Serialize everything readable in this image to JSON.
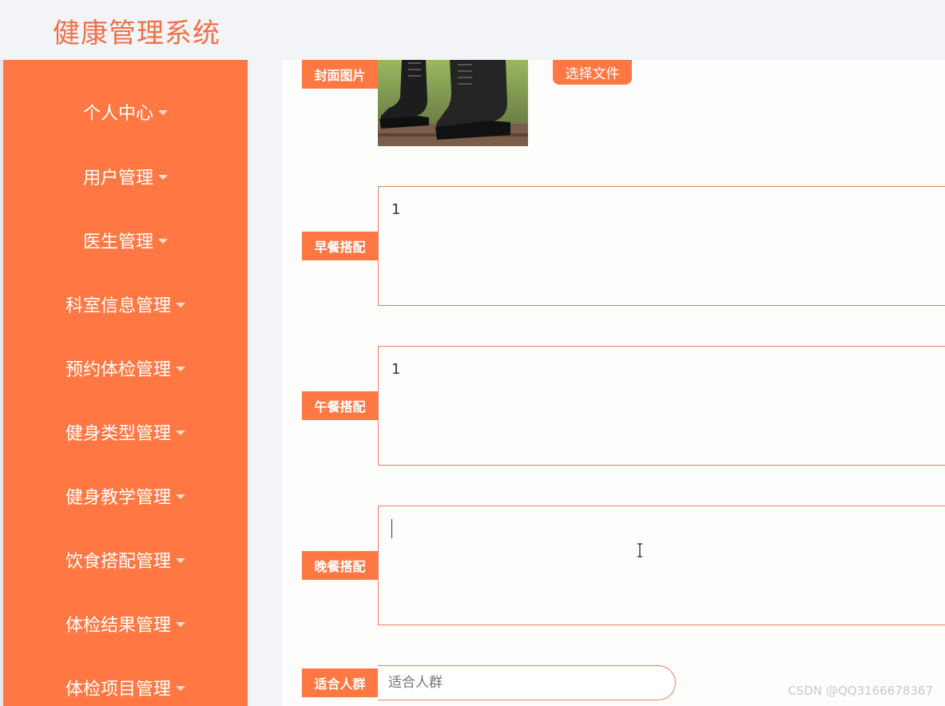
{
  "header": {
    "title": "健康管理系统"
  },
  "sidebar": {
    "items": [
      {
        "label": "个人中心"
      },
      {
        "label": "用户管理"
      },
      {
        "label": "医生管理"
      },
      {
        "label": "科室信息管理"
      },
      {
        "label": "预约体检管理"
      },
      {
        "label": "健身类型管理"
      },
      {
        "label": "健身教学管理"
      },
      {
        "label": "饮食搭配管理"
      },
      {
        "label": "体检结果管理"
      },
      {
        "label": "体检项目管理"
      }
    ]
  },
  "form": {
    "cover": {
      "label": "封面图片",
      "button": "选择文件",
      "image_icon": "boots-photo-icon"
    },
    "breakfast": {
      "label": "早餐搭配",
      "value": "1"
    },
    "lunch": {
      "label": "午餐搭配",
      "value": "1"
    },
    "dinner": {
      "label": "晚餐搭配",
      "value": ""
    },
    "crowd": {
      "label": "适合人群",
      "placeholder": "适合人群"
    }
  },
  "watermark": "CSDN @QQ3166678367",
  "colors": {
    "accent": "#ff7843",
    "title": "#f07048",
    "background": "#f3f4f8"
  }
}
